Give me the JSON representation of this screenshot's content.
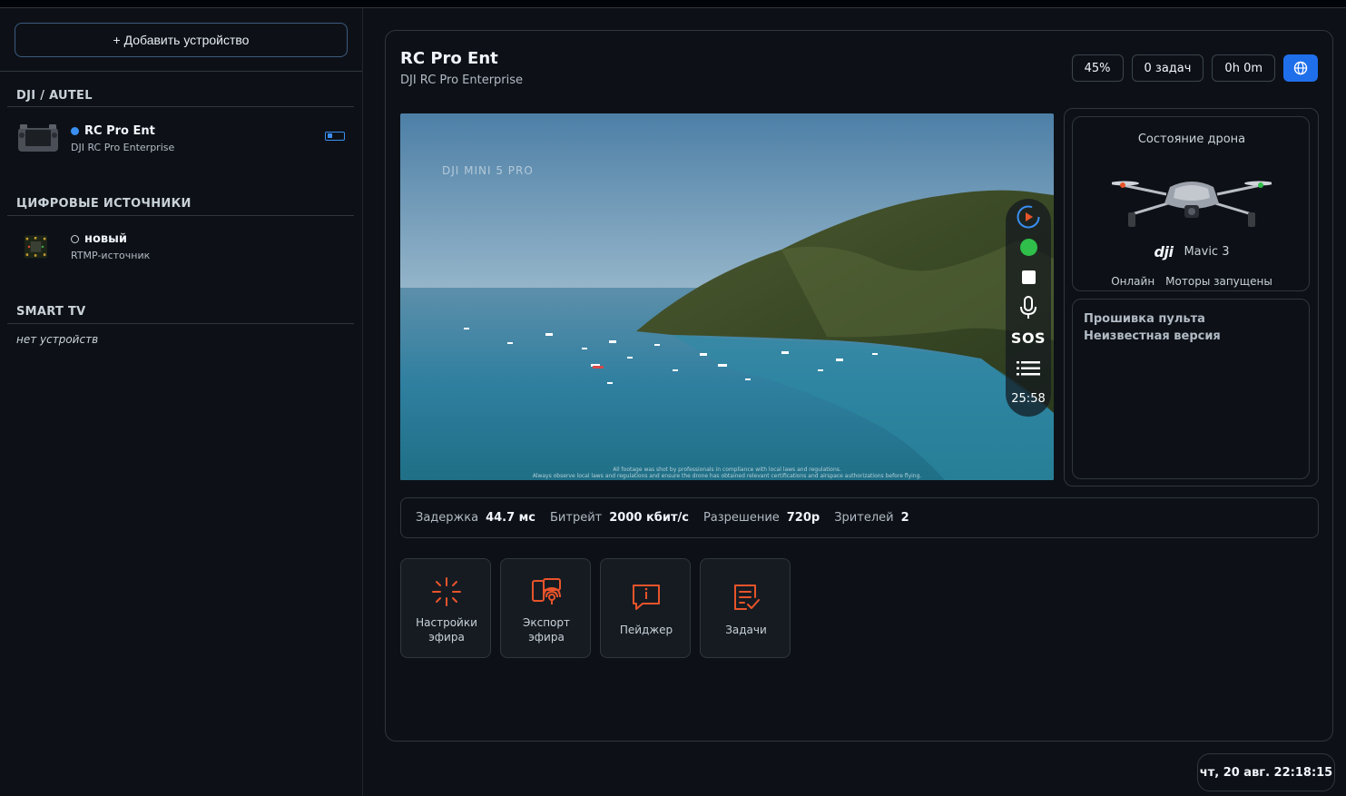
{
  "sidebar": {
    "add_button": "+ Добавить устройство",
    "groups": [
      {
        "title": "DJI / AUTEL",
        "devices": [
          {
            "name": "RC Pro Ent",
            "sub": "DJI RC Pro Enterprise",
            "status": "online"
          }
        ]
      },
      {
        "title": "ЦИФРОВЫЕ ИСТОЧНИКИ",
        "devices": [
          {
            "name": "новый",
            "sub": "RTMP-источник",
            "status": "offline"
          }
        ]
      },
      {
        "title": "SMART TV",
        "empty_text": "нет устройств"
      }
    ]
  },
  "main": {
    "title": "RC Pro Ent",
    "subtitle": "DJI RC Pro Enterprise",
    "chips": {
      "battery": "45%",
      "tasks": "0 задач",
      "duration": "0h 0m"
    },
    "video": {
      "watermark": "DJI MINI 5 PRO",
      "sos_label": "SOS",
      "time": "25:58",
      "footnote_1": "All footage was shot by professionals in compliance with local laws and regulations.",
      "footnote_2": "Always observe local laws and regulations and ensure the drone has obtained relevant certifications and airspace authorizations before flying."
    },
    "drone_state": {
      "title": "Состояние дрона",
      "brand": "dji",
      "model": "Mavic 3",
      "status_online": "Онлайн",
      "status_motors": "Моторы запущены"
    },
    "firmware": {
      "title": "Прошивка пульта",
      "value": "Неизвестная версия"
    },
    "stats": [
      {
        "label": "Задержка",
        "value": "44.7 мс"
      },
      {
        "label": "Битрейт",
        "value": "2000 кбит/с"
      },
      {
        "label": "Разрешение",
        "value": "720p"
      },
      {
        "label": "Зрителей",
        "value": "2"
      }
    ],
    "tiles": [
      {
        "line1": "Настройки",
        "line2": "эфира",
        "icon": "broadcast-settings-icon"
      },
      {
        "line1": "Экспорт",
        "line2": "эфира",
        "icon": "stream-export-icon"
      },
      {
        "line1": "Пейджер",
        "line2": "",
        "icon": "pager-icon"
      },
      {
        "line1": "Задачи",
        "line2": "",
        "icon": "tasks-icon"
      }
    ]
  },
  "clock": "чт, 20 авг. 22:18:15",
  "colors": {
    "accent": "#1f6feb",
    "online": "#3a8ef0",
    "tile_icon": "#e8542a",
    "live_green": "#2fbf4a"
  }
}
